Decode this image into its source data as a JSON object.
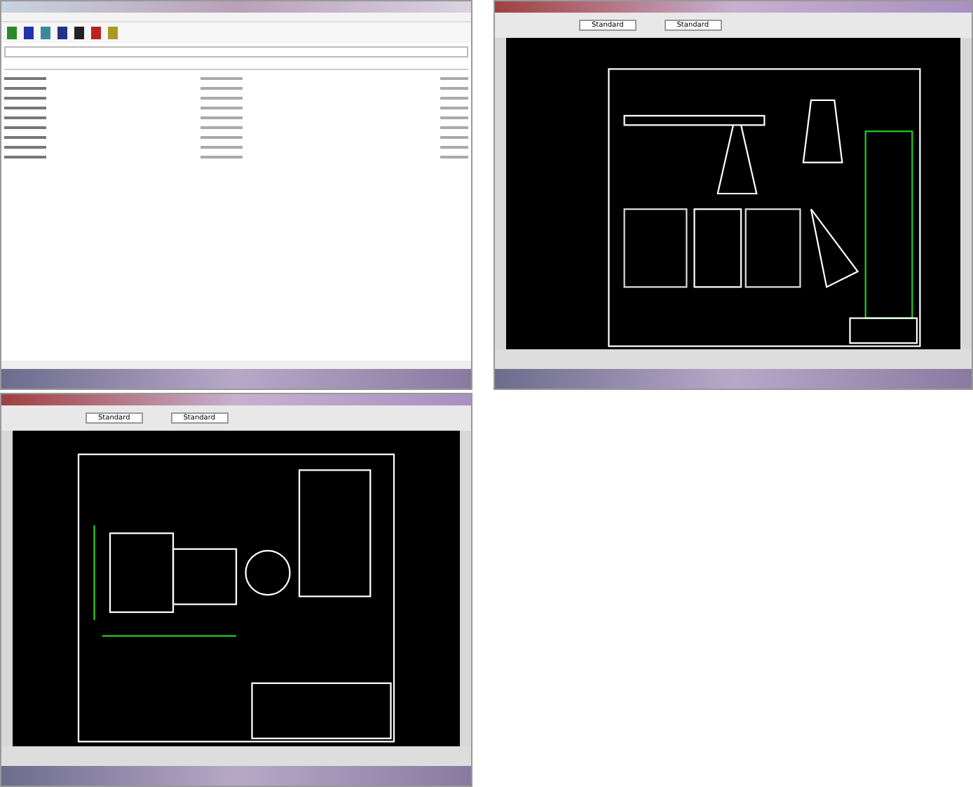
{
  "screens": [
    {
      "kind": "explorer"
    },
    {
      "kind": "cad_assembly",
      "toolbar_combos": [
        "Standard",
        "Standard"
      ]
    },
    {
      "kind": "cad_part",
      "toolbar_combos": [
        "Standard",
        "Standard"
      ]
    }
  ]
}
